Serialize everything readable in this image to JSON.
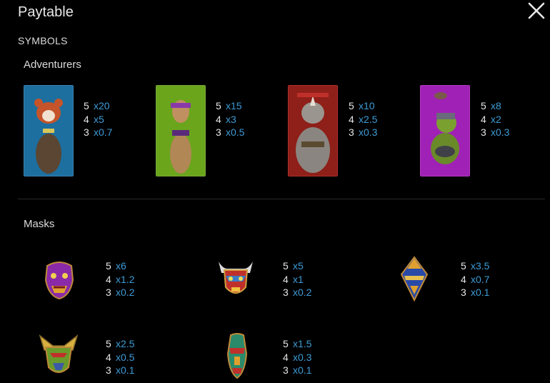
{
  "header": {
    "title": "Paytable",
    "close_icon": "close-icon"
  },
  "section_label": "SYMBOLS",
  "colors": {
    "background": "#000000",
    "multiplier": "#3d9bd6"
  },
  "adventurers": {
    "label": "Adventurers",
    "items": [
      {
        "name": "red-panda",
        "pays": [
          {
            "count": "5",
            "mult": "x20"
          },
          {
            "count": "4",
            "mult": "x5"
          },
          {
            "count": "3",
            "mult": "x0.7"
          }
        ]
      },
      {
        "name": "lizard",
        "pays": [
          {
            "count": "5",
            "mult": "x15"
          },
          {
            "count": "4",
            "mult": "x3"
          },
          {
            "count": "3",
            "mult": "x0.5"
          }
        ]
      },
      {
        "name": "rhino",
        "pays": [
          {
            "count": "5",
            "mult": "x10"
          },
          {
            "count": "4",
            "mult": "x2.5"
          },
          {
            "count": "3",
            "mult": "x0.3"
          }
        ]
      },
      {
        "name": "turtle",
        "pays": [
          {
            "count": "5",
            "mult": "x8"
          },
          {
            "count": "4",
            "mult": "x2"
          },
          {
            "count": "3",
            "mult": "x0.3"
          }
        ]
      }
    ]
  },
  "masks": {
    "label": "Masks",
    "items": [
      {
        "name": "purple-mask",
        "pays": [
          {
            "count": "5",
            "mult": "x6"
          },
          {
            "count": "4",
            "mult": "x1.2"
          },
          {
            "count": "3",
            "mult": "x0.2"
          }
        ]
      },
      {
        "name": "horned-red-mask",
        "pays": [
          {
            "count": "5",
            "mult": "x5"
          },
          {
            "count": "4",
            "mult": "x1"
          },
          {
            "count": "3",
            "mult": "x0.2"
          }
        ]
      },
      {
        "name": "blue-diamond-mask",
        "pays": [
          {
            "count": "5",
            "mult": "x3.5"
          },
          {
            "count": "4",
            "mult": "x0.7"
          },
          {
            "count": "3",
            "mult": "x0.1"
          }
        ]
      },
      {
        "name": "green-eared-mask",
        "pays": [
          {
            "count": "5",
            "mult": "x2.5"
          },
          {
            "count": "4",
            "mult": "x0.5"
          },
          {
            "count": "3",
            "mult": "x0.1"
          }
        ]
      },
      {
        "name": "tall-green-mask",
        "pays": [
          {
            "count": "5",
            "mult": "x1.5"
          },
          {
            "count": "4",
            "mult": "x0.3"
          },
          {
            "count": "3",
            "mult": "x0.1"
          }
        ]
      }
    ]
  }
}
